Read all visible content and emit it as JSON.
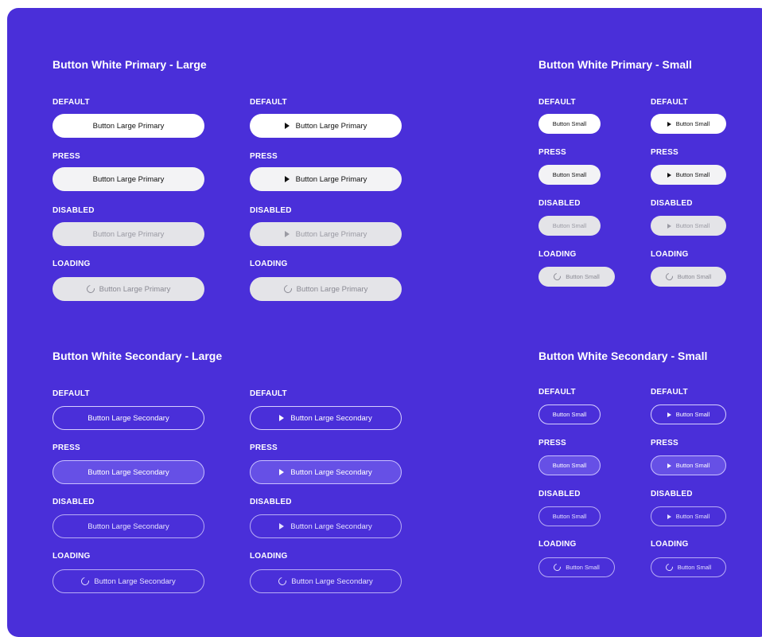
{
  "sections": {
    "primary_large": {
      "title": "Button White Primary - Large"
    },
    "primary_small": {
      "title": "Button White Primary - Small"
    },
    "secondary_large": {
      "title": "Button White Secondary - Large"
    },
    "secondary_small": {
      "title": "Button White Secondary - Small"
    }
  },
  "states": {
    "default": "DEFAULT",
    "press": "PRESS",
    "disabled": "DISABLED",
    "loading": "LOADING"
  },
  "labels": {
    "large_primary": "Button Large Primary",
    "large_secondary": "Button Large Secondary",
    "small": "Button Small"
  },
  "icons": {
    "play": "play-icon",
    "loading": "spinner-icon"
  },
  "colors": {
    "board_background": "#4a2fd9",
    "primary_button": "#ffffff",
    "disabled_button": "#e4e4e8",
    "secondary_border": "#d7d0ff",
    "secondary_press": "#6650e6"
  }
}
